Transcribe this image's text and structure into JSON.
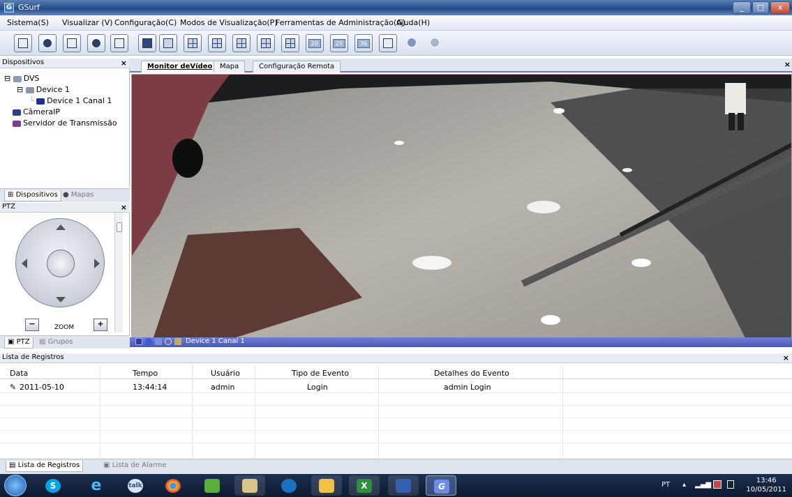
{
  "window": {
    "title": "GSurf",
    "app_icon": "G"
  },
  "menu": [
    "Sistema(S)",
    "Visualizar (V)",
    "Configuração(C)",
    "Modos de Visualização(P)",
    "Ferramentas de Administração(G)",
    "Ajuda(H)"
  ],
  "toolbar": {
    "layout_numbers": [
      "20",
      "25",
      "36"
    ]
  },
  "devices_panel": {
    "title": "Dispositivos",
    "tree": [
      {
        "label": "DVS",
        "level": 0
      },
      {
        "label": "Device 1",
        "level": 1
      },
      {
        "label": "Device 1 Canal 1",
        "level": 2
      },
      {
        "label": "CâmeraIP",
        "level": 0
      },
      {
        "label": "Servidor de Transmissão",
        "level": 0
      }
    ],
    "tabs": [
      "Dispositivos",
      "Mapas"
    ]
  },
  "ptz_panel": {
    "title": "PTZ",
    "zoom_label": "ZOOM",
    "zoom_minus": "−",
    "zoom_plus": "+",
    "tabs": [
      "PTZ",
      "Grupos"
    ]
  },
  "video": {
    "tabs": [
      "Monitor deVídeo",
      "Mapa",
      "Configuração Remota"
    ],
    "channel_label": "Device 1 Canal 1"
  },
  "log": {
    "title": "Lista de Registros",
    "columns": [
      "Data",
      "Tempo",
      "Usuário",
      "Tipo de Evento",
      "Detalhes do Evento"
    ],
    "rows": [
      {
        "data": "2011-05-10",
        "tempo": "13:44:14",
        "usuario": "admin",
        "tipo": "Login",
        "detalhes": "admin Login"
      }
    ],
    "tabs": [
      "Lista de Registros",
      "Lista de Alarme"
    ]
  },
  "taskbar": {
    "apps": [
      "skype",
      "ie",
      "talk",
      "chrome",
      "messenger",
      "explorer",
      "media",
      "folder",
      "excel",
      "notes",
      "gsurf"
    ],
    "lang": "PT",
    "time": "13:46",
    "date": "10/05/2011"
  },
  "colors": {
    "title_bar": "#2f5590",
    "video_status_bar": "#5b67c4",
    "taskbar": "#13223d"
  }
}
